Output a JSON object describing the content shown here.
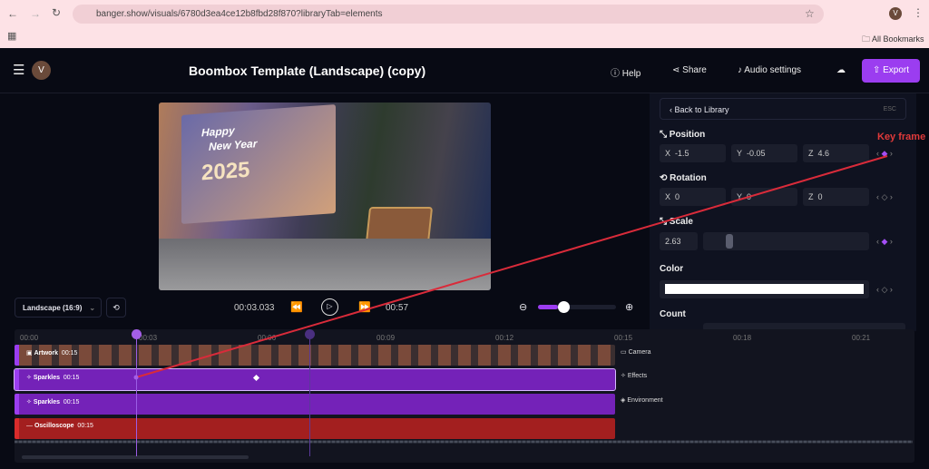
{
  "browser": {
    "url": "banger.show/visuals/6780d3ea4ce12b8fbd28f870?libraryTab=elements",
    "bookmarks": "All Bookmarks",
    "profile": "V"
  },
  "header": {
    "avatar": "V",
    "title": "Boombox Template (Landscape) (copy)",
    "help": "Help",
    "share": "Share",
    "audio": "Audio settings",
    "export": "Export"
  },
  "preview": {
    "line1": "Happy",
    "line2": "New Year",
    "year": "2025"
  },
  "controls": {
    "aspect": "Landscape (16:9)",
    "current_time": "00:03.033",
    "duration": "00:57",
    "zoom_percent": 12
  },
  "panel": {
    "back": "Back to Library",
    "esc": "ESC",
    "position": {
      "label": "Position",
      "x_label": "X",
      "x": "-1.5",
      "y_label": "Y",
      "y": "-0.05",
      "z_label": "Z",
      "z": "4.6"
    },
    "rotation": {
      "label": "Rotation",
      "x_label": "X",
      "x": "0",
      "y_label": "Y",
      "y": "0",
      "z_label": "Z",
      "z": "0"
    },
    "scale": {
      "label": "Scale",
      "value": "2.63"
    },
    "color": {
      "label": "Color",
      "value": "#ffffff"
    },
    "count": {
      "label": "Count"
    }
  },
  "annotation": {
    "label": "Key frame",
    "color": "#d92b3a"
  },
  "timeline": {
    "ticks": [
      "00:00",
      "00:03",
      "00:06",
      "00:09",
      "00:12",
      "00:15",
      "00:18",
      "00:21"
    ],
    "tracks": [
      {
        "name": "Artwork",
        "dur": "00:15"
      },
      {
        "name": "Sparkles",
        "dur": "00:15"
      },
      {
        "name": "Sparkles",
        "dur": "00:15"
      },
      {
        "name": "Oscilloscope",
        "dur": "00:15"
      }
    ],
    "side": [
      "Camera",
      "Effects",
      "Environment"
    ]
  },
  "colors": {
    "accent": "#9b3df0",
    "track_purple": "#7422b8",
    "track_red": "#a31f1f"
  }
}
